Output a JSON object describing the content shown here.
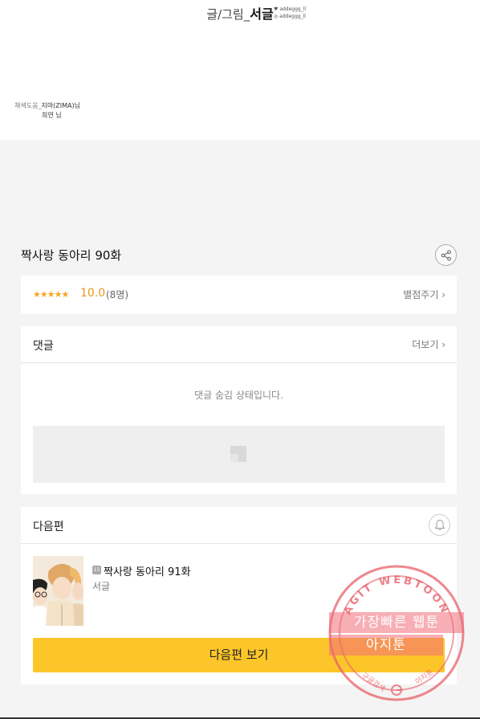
{
  "credits": {
    "main_prefix": "글/그림_",
    "author": "서글",
    "sns_twitter": "addeggg_ll",
    "sns_instagram": "addeggg_ll",
    "assist_label": "채색도움_",
    "assist_name1": "지마(ZIMA)님",
    "assist_name2": "희연 님"
  },
  "episode": {
    "title": "짝사랑 동아리 90화"
  },
  "rating": {
    "stars": "★★★★★",
    "score": "10.0",
    "votes": "(8명)",
    "rate_label": "별점주기 ›"
  },
  "comments": {
    "title": "댓글",
    "more_label": "더보기 ›",
    "hidden_message": "댓글 숨김 상태입니다."
  },
  "next_episode": {
    "section_title": "다음편",
    "age_badge": "15",
    "title": "짝사랑 동아리 91화",
    "author": "서글",
    "button_label": "다음편 보기"
  },
  "watermark": {
    "ring_text": "AGIT WEBTOON",
    "band1": "가장빠른 웹툰",
    "band2": "아지툰",
    "bottom_left": "구글검색",
    "bottom_right": "아지툰"
  },
  "colors": {
    "accent_yellow": "#fcc62a",
    "star_orange": "#f5a623",
    "stamp_red": "#e8606a"
  }
}
